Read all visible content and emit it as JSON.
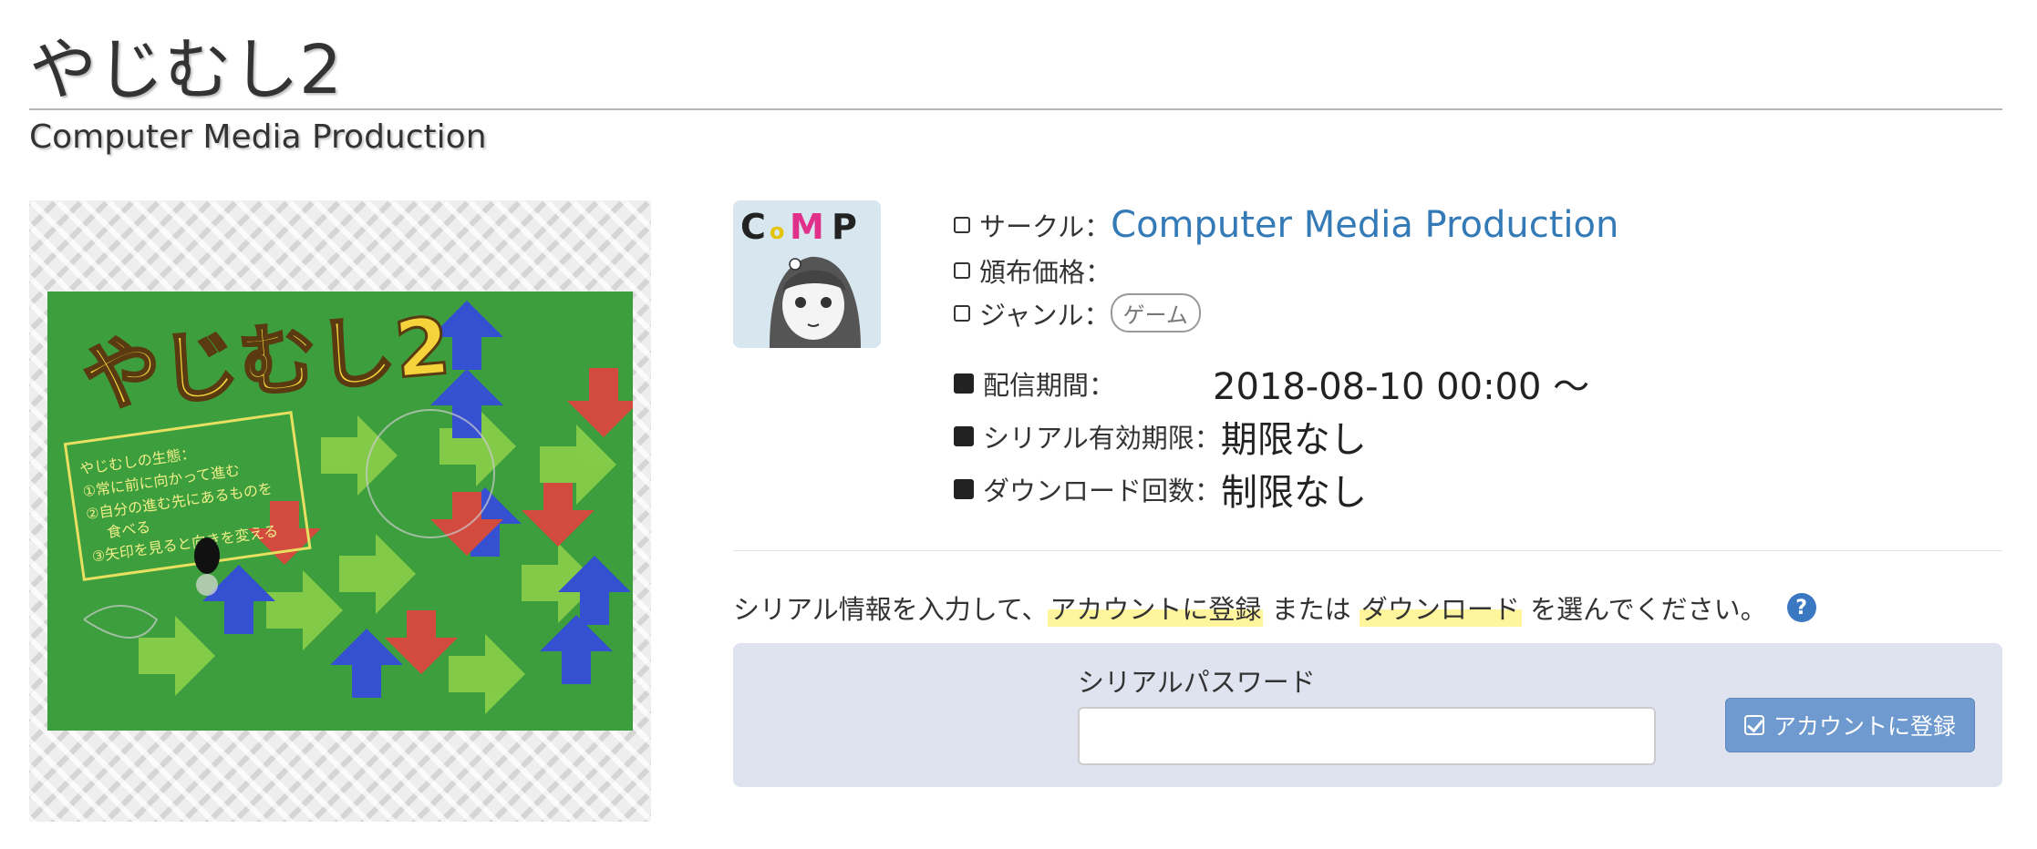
{
  "page": {
    "title": "やじむし2",
    "subtitle": "Computer Media Production"
  },
  "cover": {
    "icon": "game-cover-art",
    "logo_text": "やじむし2",
    "handwritten_notes": "やじむしの生態：①常に前に向かって進む ②自分の進む先にあるものを食べる ③矢印を見ると向きを変える",
    "colors": {
      "field": "#3c9e3c",
      "red": "#d24b3e",
      "blue": "#3550d0",
      "light_green": "#8bcf4a"
    }
  },
  "circle": {
    "avatar_icon": "circle-logo-avatar",
    "avatar_logo_text": "CoMP"
  },
  "info": {
    "circle_label": "サークル：",
    "circle_name": "Computer Media Production",
    "price_label": "頒布価格：",
    "price_value": "",
    "genre_label": "ジャンル：",
    "genre_tag": "ゲーム",
    "period_label": "配信期間：",
    "period_value": "2018-08-10 00:00 〜",
    "serial_expiry_label": "シリアル有効期限：",
    "serial_expiry_value": "期限なし",
    "download_count_label": "ダウンロード回数：",
    "download_count_value": "制限なし"
  },
  "instruction": {
    "prefix": "シリアル情報を入力して、",
    "register_link": "アカウントに登録",
    "middle": " または ",
    "download_link": "ダウンロード",
    "suffix": " を選んでください。",
    "help_icon": "?"
  },
  "serial_form": {
    "label": "シリアルパスワード",
    "value": "",
    "register_button": "アカウントに登録"
  },
  "colors": {
    "link": "#337ab7",
    "button": "#6f9ad0",
    "panel": "#dfe3ef",
    "highlight": "#fff59d"
  }
}
